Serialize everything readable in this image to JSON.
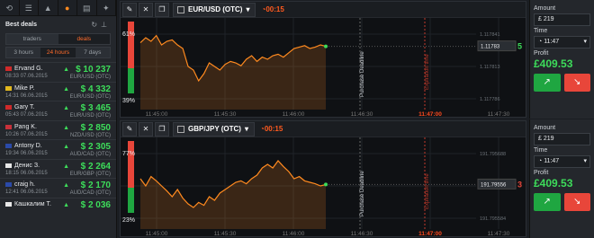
{
  "sidebar": {
    "icons": [
      "history-icon",
      "deals-icon",
      "chart-icon",
      "people-icon",
      "stats-icon",
      "settings-icon"
    ],
    "best_deals_title": "Best deals",
    "tabs": [
      "traders",
      "deals"
    ],
    "periods": [
      "3 hours",
      "24 hours",
      "7 days"
    ],
    "deals": [
      {
        "flag": "#d02a2a",
        "name": "Ervand G.",
        "time": "08:33 07.06.2015",
        "amount": "$ 10 237",
        "pair": "EUR/USD (OTC)"
      },
      {
        "flag": "#e2b81e",
        "name": "Mike P.",
        "time": "14:31 06.06.2015",
        "amount": "$ 4 332",
        "pair": "EUR/USD (OTC)"
      },
      {
        "flag": "#d02a2a",
        "name": "Gary T.",
        "time": "05:43 07.06.2015",
        "amount": "$ 3 465",
        "pair": "EUR/USD (OTC)"
      },
      {
        "flag": "#c8313a",
        "name": "Pang K.",
        "time": "10:26 07.06.2015",
        "amount": "$ 2 850",
        "pair": "NZD/USD (OTC)"
      },
      {
        "flag": "#2b4aa8",
        "name": "Antony D.",
        "time": "19:34 06.06.2015",
        "amount": "$ 2 305",
        "pair": "AUD/CAD (OTC)"
      },
      {
        "flag": "#e8e8e8",
        "name": "Денис З.",
        "time": "18:15 06.06.2015",
        "amount": "$ 2 264",
        "pair": "EUR/GBP (OTC)"
      },
      {
        "flag": "#2b4aa8",
        "name": "craig h.",
        "time": "12:41 06.06.2015",
        "amount": "$ 2 170",
        "pair": "AUD/CAD (OTC)"
      },
      {
        "flag": "#e8e8e8",
        "name": "Кашкалим Т.",
        "time": "",
        "amount": "$ 2 036",
        "pair": ""
      }
    ]
  },
  "panels": [
    {
      "asset": "EUR/USD (OTC)",
      "timer": "00:15",
      "put_pct": "61%",
      "call_pct": "39%",
      "current_price": "1.11783",
      "badge_value": "5",
      "price_levels": [
        "1.117841",
        "1.117813",
        "1.117786"
      ],
      "time_labels": [
        "11:45:00",
        "11:45:30",
        "11:46:00",
        "11:46:30",
        "11:47:00",
        "11:47:30"
      ],
      "purchase_label": "Purchase Deadline",
      "expiration_label": "Expiration time"
    },
    {
      "asset": "GBP/JPY (OTC)",
      "timer": "00:15",
      "put_pct": "77%",
      "call_pct": "23%",
      "current_price": "191.79556",
      "badge_value": "3",
      "price_levels": [
        "191.795688",
        "191.795636",
        "191.795584"
      ],
      "time_labels": [
        "11:45:00",
        "11:45:30",
        "11:46:00",
        "11:46:30",
        "11:47:00",
        "11:47:30"
      ],
      "purchase_label": "Purchase Deadline",
      "expiration_label": "Expiration time"
    }
  ],
  "trade": [
    {
      "amount_label": "Amount",
      "amount": "219",
      "time_label": "Time",
      "time": "11:47",
      "profit_label": "Profit",
      "profit": "£409.53"
    },
    {
      "amount_label": "Amount",
      "amount": "219",
      "time_label": "Time",
      "time": "11:47",
      "profit_label": "Profit",
      "profit": "£409.53"
    }
  ],
  "colors": {
    "accent": "#ff6b2b",
    "up": "#3ddc5a",
    "down": "#e8463a",
    "line": "#ff8a1f"
  }
}
